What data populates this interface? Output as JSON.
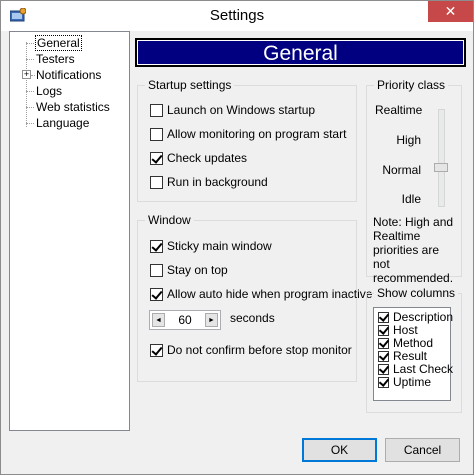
{
  "window": {
    "title": "Settings",
    "close_glyph": "✕",
    "icon": "settings-app-icon"
  },
  "tree": {
    "items": [
      {
        "label": "General",
        "selected": true
      },
      {
        "label": "Testers"
      },
      {
        "label": "Notifications",
        "expandable": true,
        "expander": "+"
      },
      {
        "label": "Logs"
      },
      {
        "label": "Web statistics"
      },
      {
        "label": "Language"
      }
    ]
  },
  "header": {
    "title": "General",
    "bg_color": "#000080"
  },
  "startup": {
    "title": "Startup settings",
    "options": [
      {
        "label": "Launch on Windows startup",
        "checked": false
      },
      {
        "label": "Allow monitoring on program start",
        "checked": false
      },
      {
        "label": "Check updates",
        "checked": true
      },
      {
        "label": "Run in background",
        "checked": false
      }
    ]
  },
  "window_group": {
    "title": "Window",
    "options": [
      {
        "label": "Sticky main window",
        "checked": true
      },
      {
        "label": "Stay on top",
        "checked": false
      },
      {
        "label": "Allow auto hide when program inactive",
        "checked": true
      },
      {
        "label": "Do not confirm before stop monitor",
        "checked": true
      }
    ],
    "spinner": {
      "value": "60",
      "unit": "seconds",
      "left_arrow": "◄",
      "right_arrow": "►"
    }
  },
  "priority": {
    "title": "Priority class",
    "levels": [
      "Realtime",
      "High",
      "Normal",
      "Idle"
    ],
    "selected": "Normal",
    "note": "Note: High and Realtime priorities are not recommended."
  },
  "columns": {
    "title": "Show columns",
    "items": [
      {
        "label": "Description",
        "checked": true
      },
      {
        "label": "Host",
        "checked": true
      },
      {
        "label": "Method",
        "checked": true
      },
      {
        "label": "Result",
        "checked": true
      },
      {
        "label": "Last Check",
        "checked": true
      },
      {
        "label": "Uptime",
        "checked": true
      }
    ]
  },
  "buttons": {
    "ok": "OK",
    "cancel": "Cancel"
  }
}
